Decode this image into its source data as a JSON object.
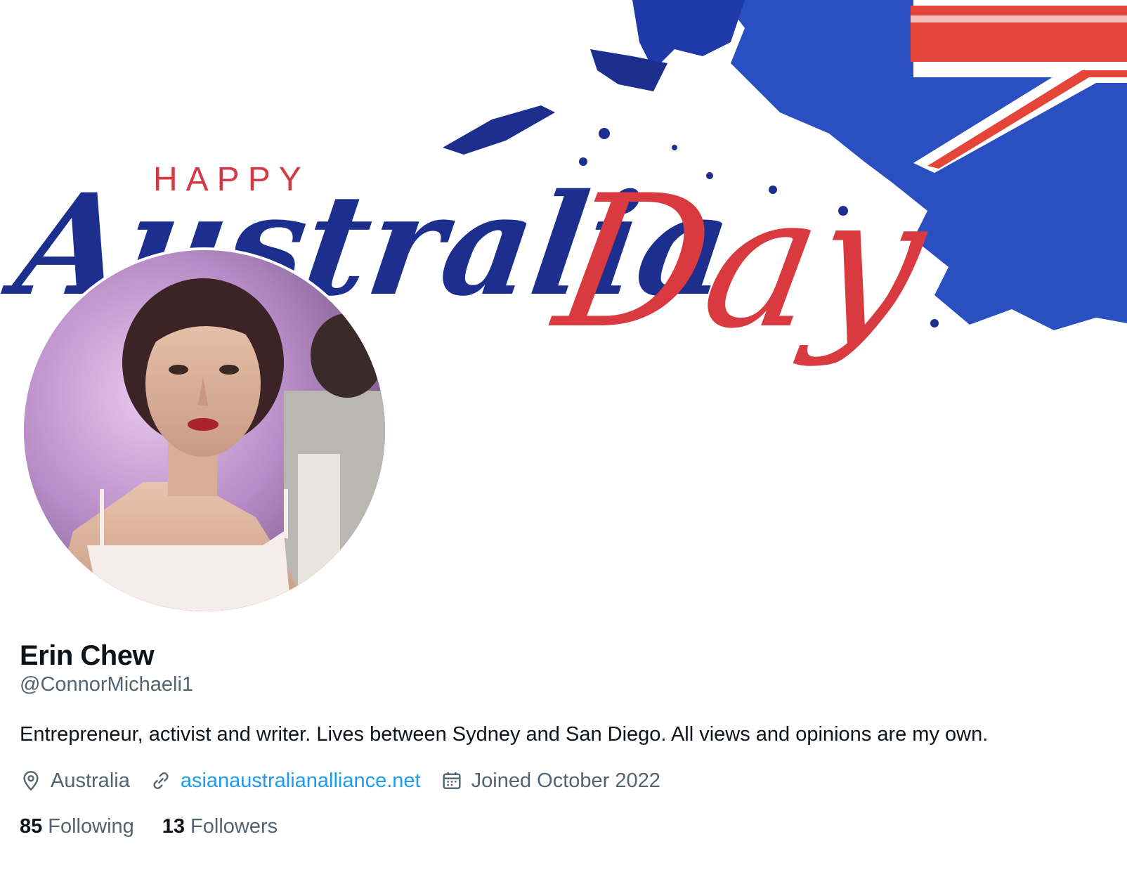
{
  "banner": {
    "happy_text": "HAPPY",
    "script_line_1": "Australia",
    "script_line_2": "Day"
  },
  "profile": {
    "display_name": "Erin Chew",
    "handle": "@ConnorMichaeli1",
    "bio": "Entrepreneur, activist and writer. Lives between Sydney and San Diego. All views and opinions are my own.",
    "location": "Australia",
    "website": "asianaustralianalliance.net",
    "joined": "Joined October 2022",
    "following_count": "85",
    "following_label": "Following",
    "followers_count": "13",
    "followers_label": "Followers"
  },
  "icons": {
    "location": "location-pin-icon",
    "website": "link-icon",
    "joined": "calendar-icon"
  },
  "colors": {
    "text_primary": "#0f1419",
    "text_secondary": "#536471",
    "link": "#1d9bf0",
    "banner_blue": "#1c2f8e",
    "banner_red": "#d83a3f"
  }
}
